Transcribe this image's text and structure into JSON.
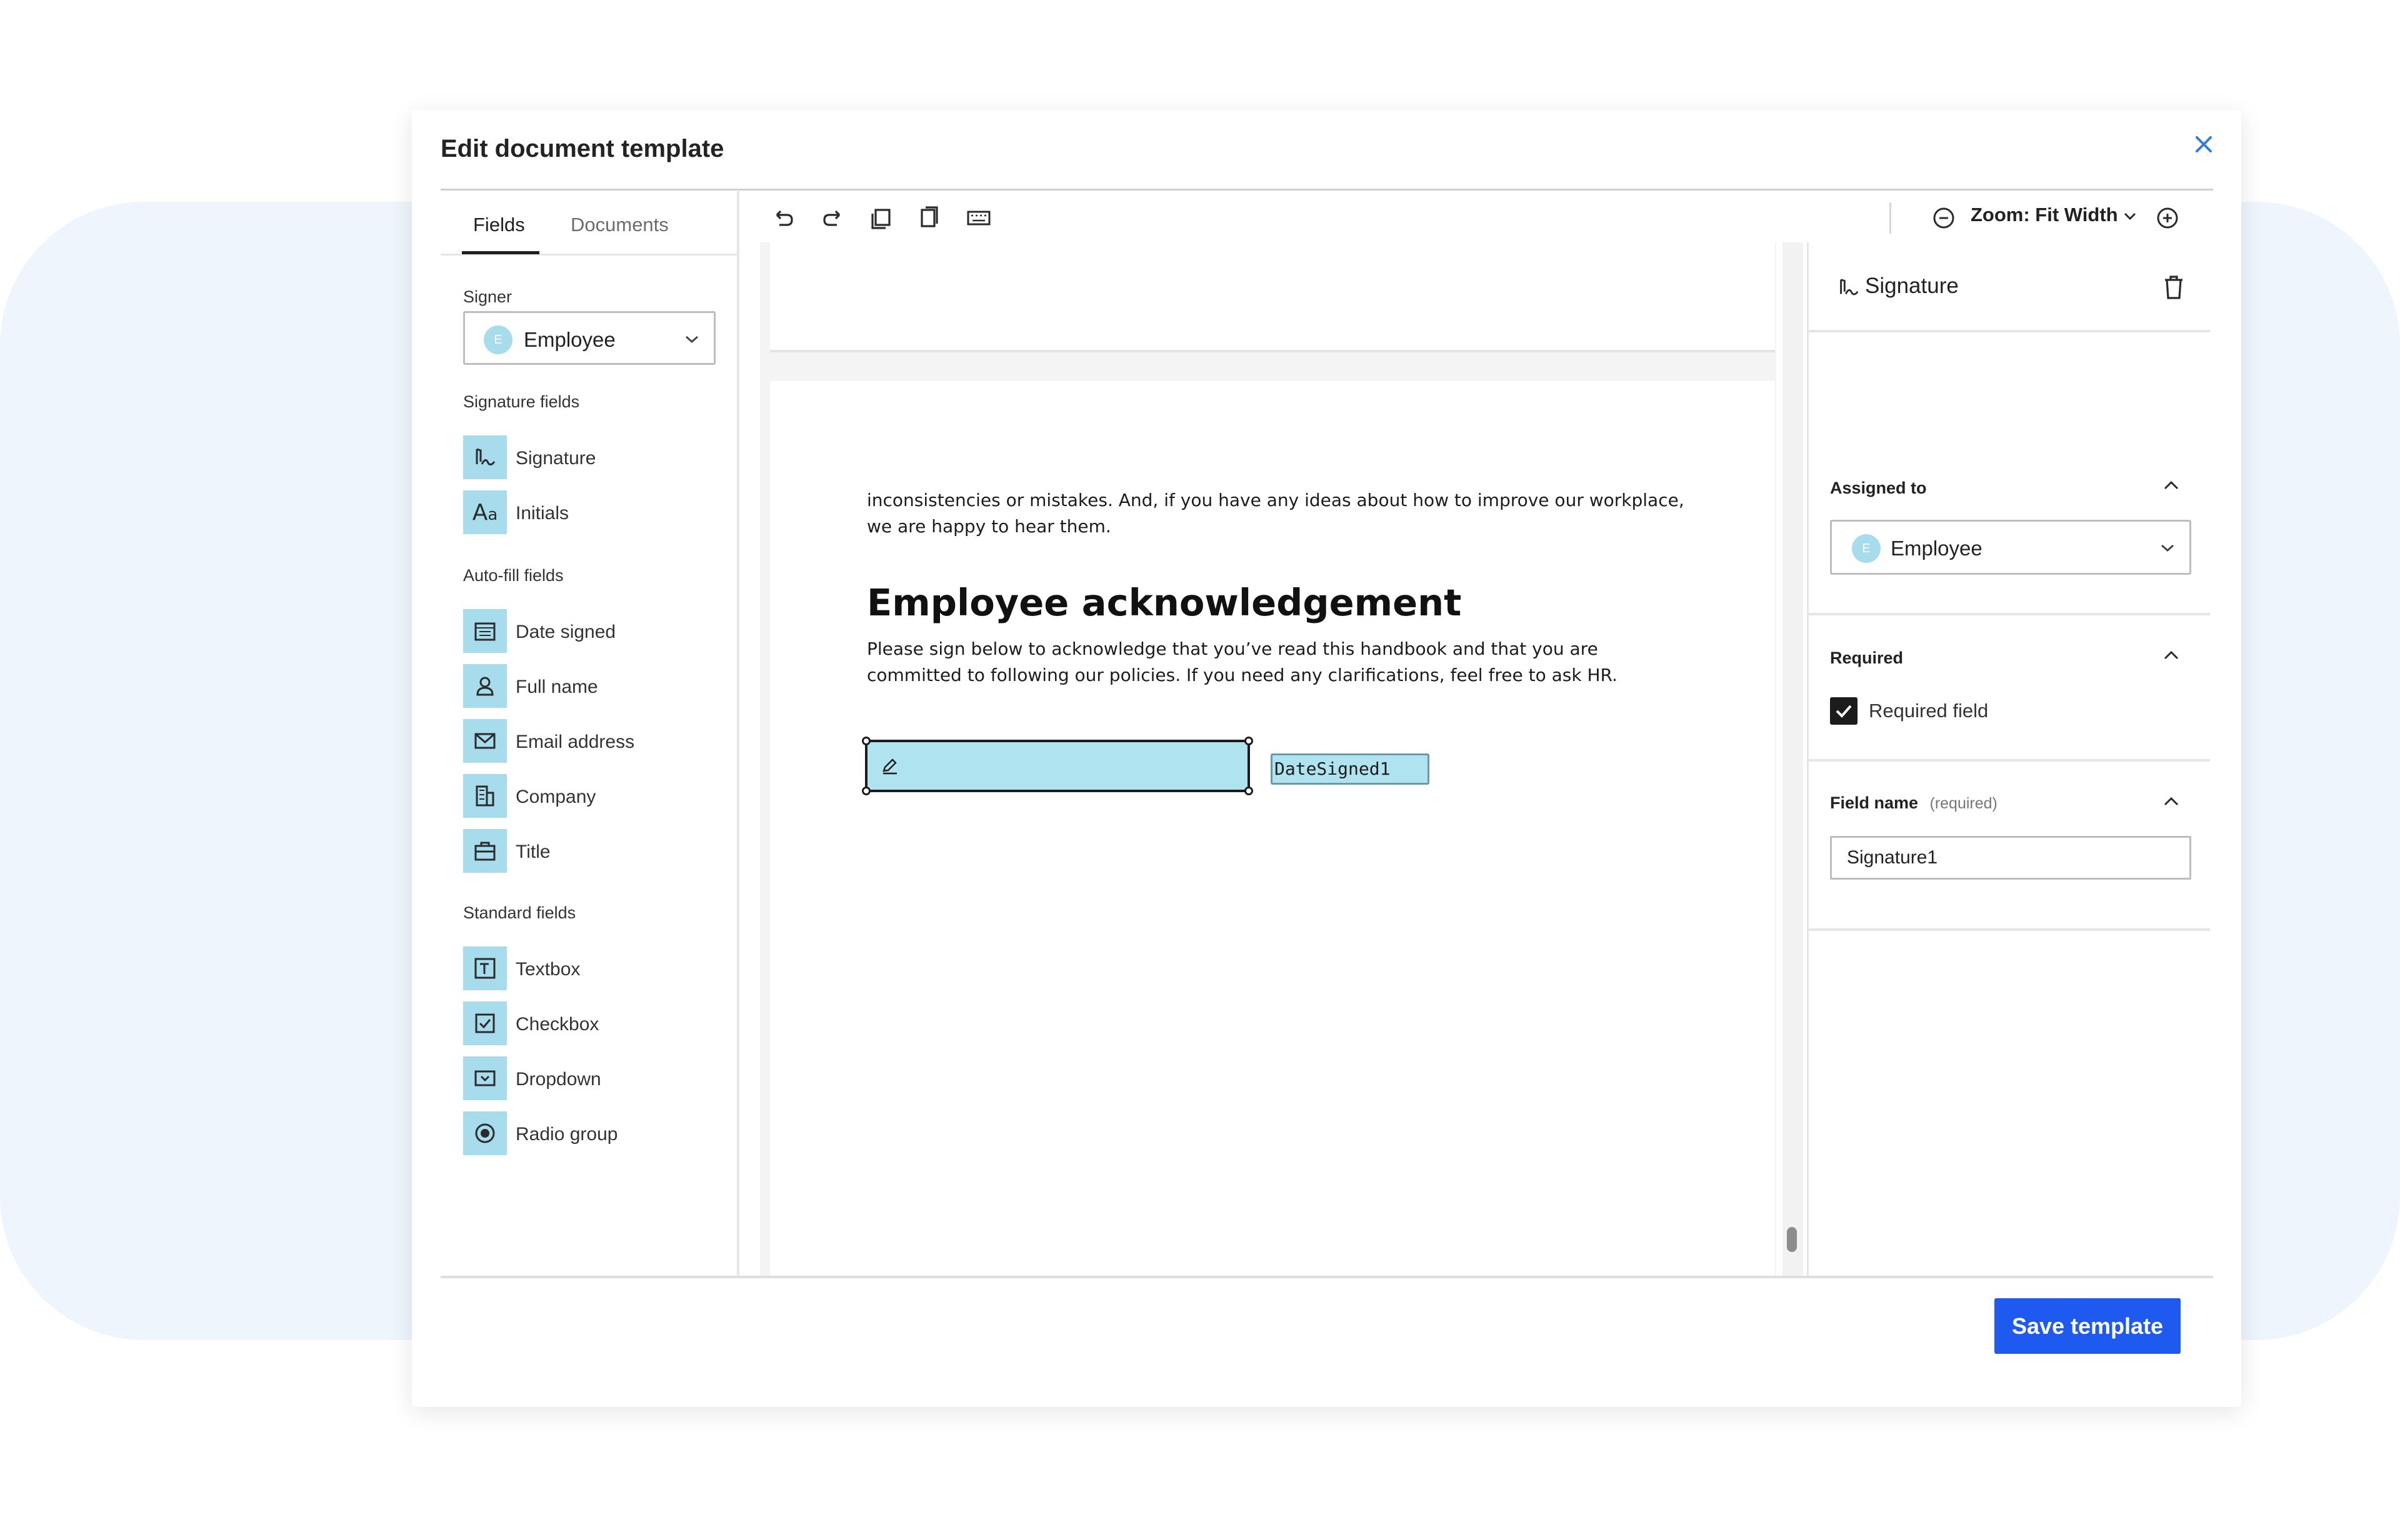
{
  "modal": {
    "title": "Edit document template"
  },
  "left_panel": {
    "tabs": [
      {
        "label": "Fields"
      },
      {
        "label": "Documents"
      }
    ],
    "signer_label": "Signer",
    "signer": {
      "initial": "E",
      "value": "Employee"
    },
    "groups": [
      {
        "label": "Signature fields",
        "items": [
          {
            "label": "Signature",
            "icon": "signature-icon"
          },
          {
            "label": "Initials",
            "icon": "initials-icon"
          }
        ]
      },
      {
        "label": "Auto-fill fields",
        "items": [
          {
            "label": "Date signed",
            "icon": "calendar-icon"
          },
          {
            "label": "Full name",
            "icon": "person-icon"
          },
          {
            "label": "Email address",
            "icon": "envelope-icon"
          },
          {
            "label": "Company",
            "icon": "building-icon"
          },
          {
            "label": "Title",
            "icon": "briefcase-icon"
          }
        ]
      },
      {
        "label": "Standard fields",
        "items": [
          {
            "label": "Textbox",
            "icon": "textbox-icon"
          },
          {
            "label": "Checkbox",
            "icon": "checkbox-icon"
          },
          {
            "label": "Dropdown",
            "icon": "dropdown-icon"
          },
          {
            "label": "Radio group",
            "icon": "radio-icon"
          }
        ]
      }
    ]
  },
  "toolbar": {
    "buttons": [
      "undo-icon",
      "redo-icon",
      "copy-icon",
      "paste-icon",
      "keyboard-icon"
    ],
    "zoom_label": "Zoom: Fit Width"
  },
  "document": {
    "para1_line1": "inconsistencies or mistakes. And, if you have any ideas about how to improve our  workplace,",
    "para1_line2": "we are happy to hear them.",
    "heading": "Employee acknowledgement",
    "para2_line1": "Please sign below to acknowledge that you’ve read this handbook and that you are",
    "para2_line2": "committed to following our policies. If you need any clarifications, feel free to ask HR.",
    "date_field_label": "DateSigned1"
  },
  "right_panel": {
    "title": "Signature",
    "assigned_to_label": "Assigned to",
    "assignee": {
      "initial": "E",
      "value": "Employee"
    },
    "required_label": "Required",
    "required_field_label": "Required field",
    "required_checked": true,
    "field_name_label": "Field name",
    "field_name_hint": "(required)",
    "field_name_value": "Signature1"
  },
  "footer": {
    "save_label": "Save template"
  },
  "colors": {
    "accent": "#1f5af0",
    "field_fill": "#aee3ef",
    "icon_bg": "#a7dcec"
  }
}
